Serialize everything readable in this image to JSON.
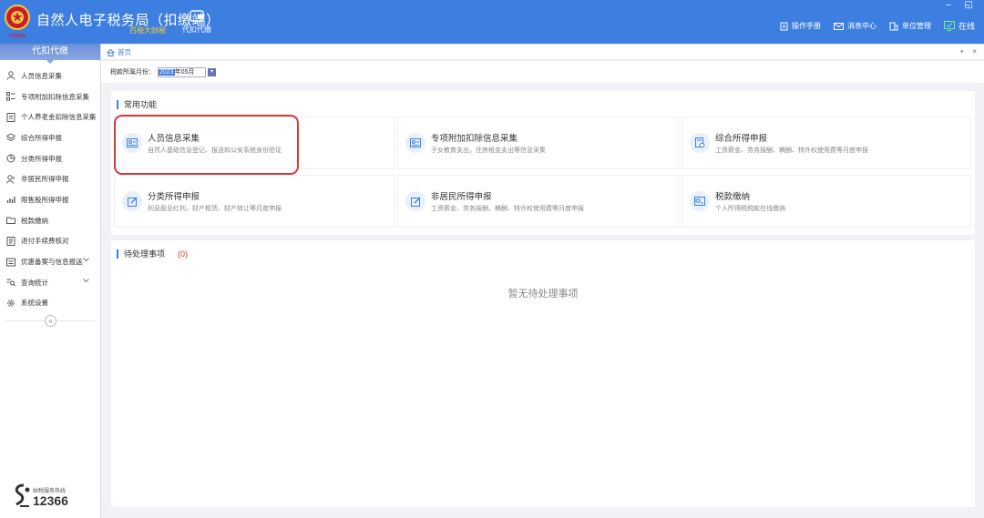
{
  "header": {
    "title": "自然人电子税务局（扣缴端）",
    "subtitle": "百税大财税",
    "nav_tab_label": "代扣代缴",
    "logo_text": "中国税务",
    "window_controls": "– ◱",
    "links": [
      {
        "label": "操作手册",
        "icon": "manual-icon"
      },
      {
        "label": "消息中心",
        "icon": "mail-icon"
      },
      {
        "label": "单位管理",
        "icon": "building-icon"
      },
      {
        "label": "在线",
        "icon": "online-monitor-icon"
      }
    ]
  },
  "sidebar": {
    "heading": "代扣代缴",
    "items": [
      {
        "label": "人员信息采集",
        "icon": "person-icon"
      },
      {
        "label": "专项附加扣除信息采集",
        "icon": "list-icon"
      },
      {
        "label": "个人养老金扣除信息采集",
        "icon": "pension-icon"
      },
      {
        "label": "综合所得申报",
        "icon": "layers-icon"
      },
      {
        "label": "分类所得申报",
        "icon": "pie-icon"
      },
      {
        "label": "非居民所得申报",
        "icon": "person-outline-icon"
      },
      {
        "label": "限售股所得申报",
        "icon": "chart-icon"
      },
      {
        "label": "税款缴纳",
        "icon": "folder-icon"
      },
      {
        "label": "退付手续费核对",
        "icon": "doc-icon"
      },
      {
        "label": "优惠备案与信息报送",
        "icon": "tag-icon",
        "has_chevron": true
      },
      {
        "label": "查询统计",
        "icon": "query-icon",
        "has_chevron": true
      },
      {
        "label": "系统设置",
        "icon": "gear-icon"
      }
    ],
    "collapse_symbol": "«",
    "hotline_label": "纳税服务热线",
    "hotline_number": "12366"
  },
  "breadcrumb": {
    "home": "首页",
    "right_controls": "▪ ×"
  },
  "period": {
    "label": "税款所属月份：",
    "year": "2023",
    "month_suffix": "年05月",
    "drop_symbol": "▾"
  },
  "common_functions": {
    "title": "常用功能",
    "items": [
      {
        "name": "人员信息采集",
        "desc": "自然人基础信息登记、报送和公安系统身份验证",
        "icon": "id-card-icon"
      },
      {
        "name": "专项附加扣除信息采集",
        "desc": "子女教育支出，住房租金支出等信息采集",
        "icon": "id-card-icon"
      },
      {
        "name": "综合所得申报",
        "desc": "工资薪金、劳务报酬、稿酬、特许权使用费等月度申报",
        "icon": "doc-gear-icon"
      },
      {
        "name": "分类所得申报",
        "desc": "利息股息红利、财产租赁、财产转让等月度申报",
        "icon": "edit-icon"
      },
      {
        "name": "非居民所得申报",
        "desc": "工资薪金、劳务报酬、稿酬、特许权使用费等月度申报",
        "icon": "edit-icon"
      },
      {
        "name": "税款缴纳",
        "desc": "个人所得税税款在线缴纳",
        "icon": "card-icon"
      }
    ]
  },
  "pending": {
    "title": "待处理事项",
    "count": "(0)",
    "empty_text": "暂无待处理事项"
  },
  "colors": {
    "primary": "#3d7fe0",
    "highlight": "#d83a3a"
  }
}
